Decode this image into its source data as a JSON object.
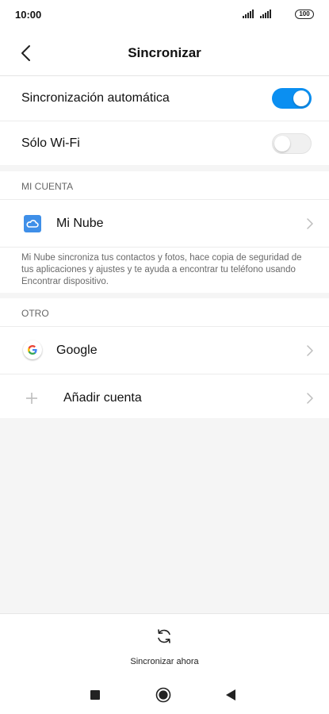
{
  "status_bar": {
    "time": "10:00",
    "battery": "100"
  },
  "header": {
    "title": "Sincronizar",
    "back_icon": "chevron-left-icon"
  },
  "toggles": {
    "auto_sync": {
      "label": "Sincronización automática",
      "state": "on"
    },
    "wifi_only": {
      "label": "Sólo Wi-Fi",
      "state": "off"
    }
  },
  "sections": {
    "my_account": {
      "header": "MI CUENTA",
      "item_label": "Mi Nube",
      "item_icon": "cloud-icon",
      "description": "Mi Nube sincroniza tus contactos y fotos, hace copia de seguridad de tus aplicaciones y ajustes y te ayuda a encontrar tu teléfono usando Encontrar dispositivo."
    },
    "other": {
      "header": "OTRO",
      "items": [
        {
          "label": "Google",
          "icon": "google-icon"
        },
        {
          "label": "Añadir cuenta",
          "icon": "plus-icon"
        }
      ]
    }
  },
  "bottom_action": {
    "label": "Sincronizar ahora",
    "icon": "sync-icon"
  },
  "colors": {
    "accent": "#0b8ff1",
    "background": "#f5f5f5"
  }
}
